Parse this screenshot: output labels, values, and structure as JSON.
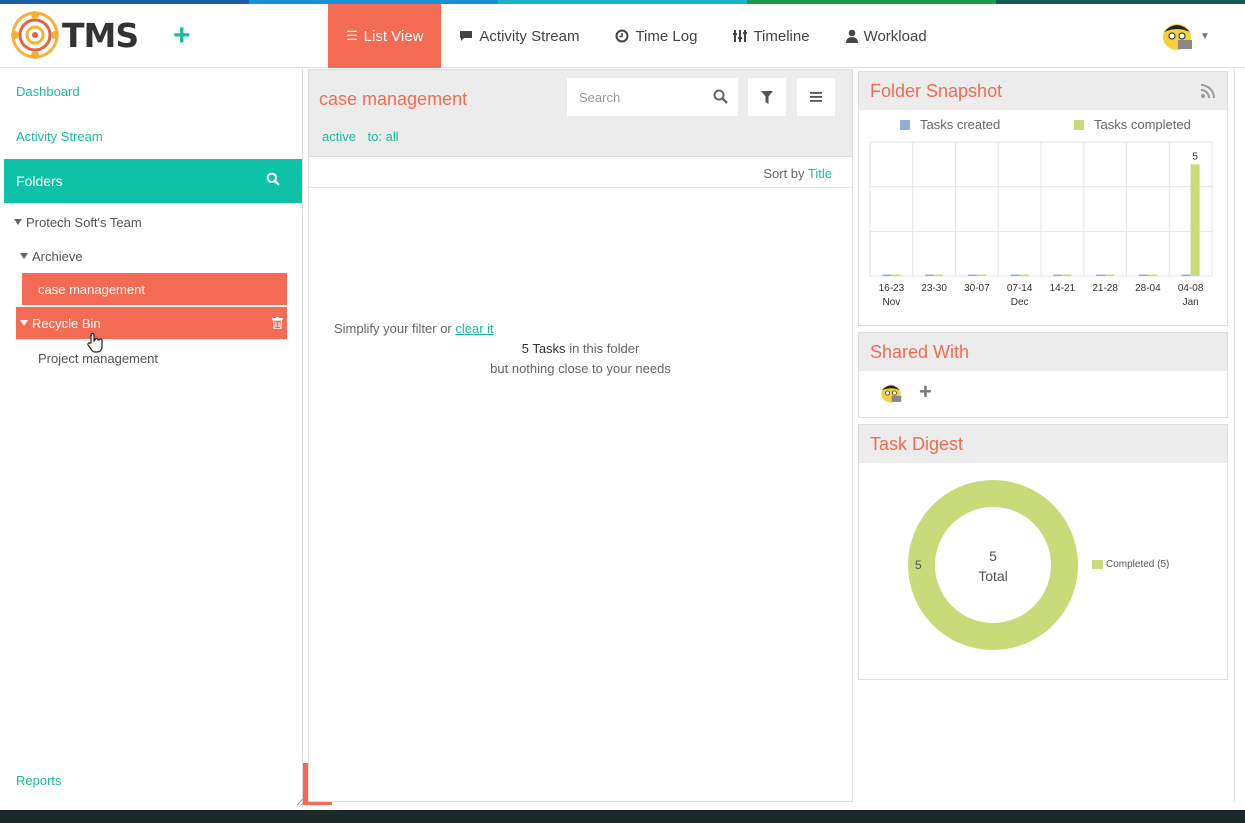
{
  "colors": {
    "accent": "#f26b52",
    "teal": "#0ec2a7",
    "created": "#8fb0d9",
    "completed": "#c8db78"
  },
  "header": {
    "logo_text": "TMS",
    "add_label": "+",
    "nav": [
      {
        "label": "List View",
        "icon": "list-icon",
        "active": true
      },
      {
        "label": "Activity Stream",
        "icon": "comment-icon"
      },
      {
        "label": "Time Log",
        "icon": "clock-icon"
      },
      {
        "label": "Timeline",
        "icon": "timeline-icon"
      },
      {
        "label": "Workload",
        "icon": "user-icon"
      }
    ]
  },
  "sidebar": {
    "dashboard": "Dashboard",
    "activity_stream": "Activity Stream",
    "folders": "Folders",
    "team": "Protech Soft's Team",
    "archieve": "Archieve",
    "case_management": "case management",
    "recycle_bin": "Recycle Bin",
    "project_management": "Project management",
    "reports": "Reports"
  },
  "main": {
    "title": "case management",
    "search_placeholder": "Search",
    "filter_active": "active",
    "filter_to": "to: all",
    "sort_prefix": "Sort by",
    "sort_value": "Title",
    "empty_prefix": "Simplify your filter or",
    "empty_link": "clear it",
    "empty_count": "5 Tasks",
    "empty_suffix": "in this folder",
    "empty_line3": "but nothing close to your needs"
  },
  "snapshot": {
    "title": "Folder Snapshot",
    "chart_data": {
      "type": "bar",
      "categories": [
        "16-23",
        "23-30",
        "30-07",
        "07-14",
        "14-21",
        "21-28",
        "28-04",
        "04-08"
      ],
      "month_labels": [
        "Nov",
        "",
        "",
        "Dec",
        "",
        "",
        "",
        "Jan"
      ],
      "series": [
        {
          "name": "Tasks created",
          "values": [
            0,
            0,
            0,
            0,
            0,
            0,
            0,
            0
          ]
        },
        {
          "name": "Tasks completed",
          "values": [
            0,
            0,
            0,
            0,
            0,
            0,
            0,
            5
          ]
        }
      ],
      "data_labels": {
        "7": "5"
      },
      "ylim": [
        0,
        6
      ],
      "legend": "top"
    }
  },
  "shared": {
    "title": "Shared With",
    "add": "+"
  },
  "digest": {
    "title": "Task Digest",
    "center_count": "5",
    "center_label": "Total",
    "chart_data": {
      "type": "pie",
      "slices": [
        {
          "name": "Completed",
          "value": 5
        }
      ],
      "legend_label": "Completed (5)",
      "slice_label": "5"
    }
  }
}
